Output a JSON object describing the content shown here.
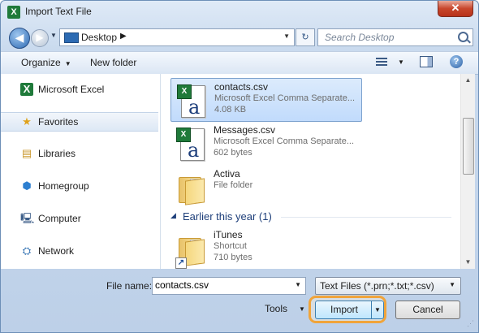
{
  "window": {
    "title": "Import Text File",
    "app_icon": "X",
    "close_glyph": "✕"
  },
  "address": {
    "location": "Desktop",
    "search_placeholder": "Search Desktop"
  },
  "toolbar": {
    "organize": "Organize",
    "new_folder": "New folder",
    "help": "?"
  },
  "navpane": {
    "items": [
      {
        "label": "Microsoft Excel",
        "icon": "excel-icon",
        "glyph": "X"
      },
      {
        "label": "Favorites",
        "icon": "star-icon",
        "glyph": "★",
        "selected": true
      },
      {
        "label": "Libraries",
        "icon": "libraries-icon",
        "glyph": "▤"
      },
      {
        "label": "Homegroup",
        "icon": "homegroup-icon",
        "glyph": "⬢"
      },
      {
        "label": "Computer",
        "icon": "computer-icon",
        "glyph": "🖳"
      },
      {
        "label": "Network",
        "icon": "network-icon",
        "glyph": "⛭"
      }
    ]
  },
  "files": [
    {
      "name": "contacts.csv",
      "type": "Microsoft Excel Comma Separate...",
      "size": "4.08 KB",
      "icon": "csv-file-icon",
      "selected": true
    },
    {
      "name": "Messages.csv",
      "type": "Microsoft Excel Comma Separate...",
      "size": "602 bytes",
      "icon": "csv-file-icon"
    },
    {
      "name": "Activa",
      "type": "File folder",
      "size": "",
      "icon": "folder-icon"
    },
    {
      "name": "iTunes",
      "type": "Shortcut",
      "size": "710 bytes",
      "icon": "shortcut-folder-icon"
    }
  ],
  "group": {
    "label": "Earlier this year (1)"
  },
  "bottom": {
    "file_name_label": "File name:",
    "file_name_value": "contacts.csv",
    "filter": "Text Files (*.prn;*.txt;*.csv)",
    "tools": "Tools",
    "import": "Import",
    "cancel": "Cancel"
  },
  "colors": {
    "highlight_ring": "#f0a43a",
    "selection": "#c1dbfc"
  }
}
